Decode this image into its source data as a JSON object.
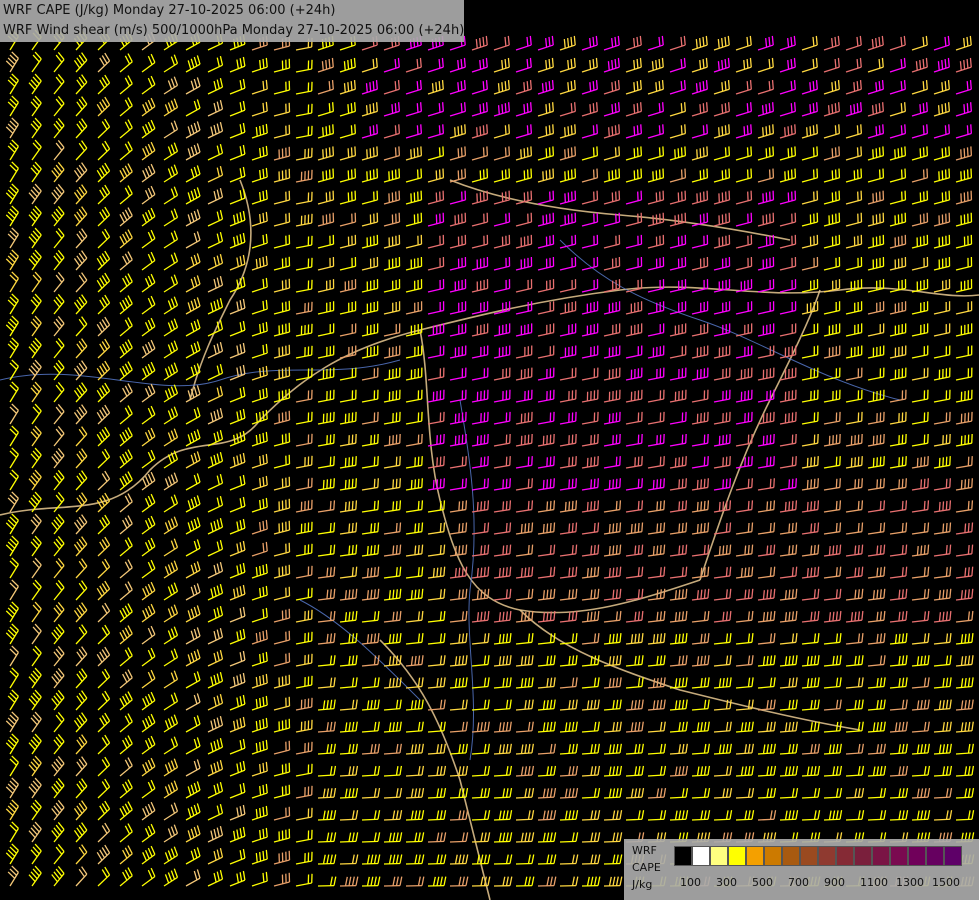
{
  "titles": {
    "line1": "WRF CAPE (J/kg) Monday 27-10-2025 06:00 (+24h)",
    "line2": "WRF Wind shear (m/s) 500/1000hPa Monday 27-10-2025 06:00 (+24h)"
  },
  "legend": {
    "model": "WRF",
    "variable": "CAPE",
    "unit": "J/kg",
    "colors": [
      "#000000",
      "#ffffff",
      "#ffff80",
      "#ffff00",
      "#f4a000",
      "#cc7a00",
      "#a85a10",
      "#9a4a20",
      "#8f3a30",
      "#852a35",
      "#7a1f3c",
      "#7a1445",
      "#7a0a50",
      "#70005a",
      "#660060",
      "#5e0068"
    ],
    "ticks": [
      "100",
      "300",
      "500",
      "700",
      "900",
      "1100",
      "1300",
      "1500"
    ]
  },
  "barb_colors": [
    "#ffff00",
    "#e8a068",
    "#e87070",
    "#ff00ff",
    "#ffd840",
    "#f4c878"
  ],
  "colors": {
    "background": "#000000",
    "border": "#e8c890",
    "river": "#5b7fd6",
    "panel": "#aaaaaa"
  }
}
